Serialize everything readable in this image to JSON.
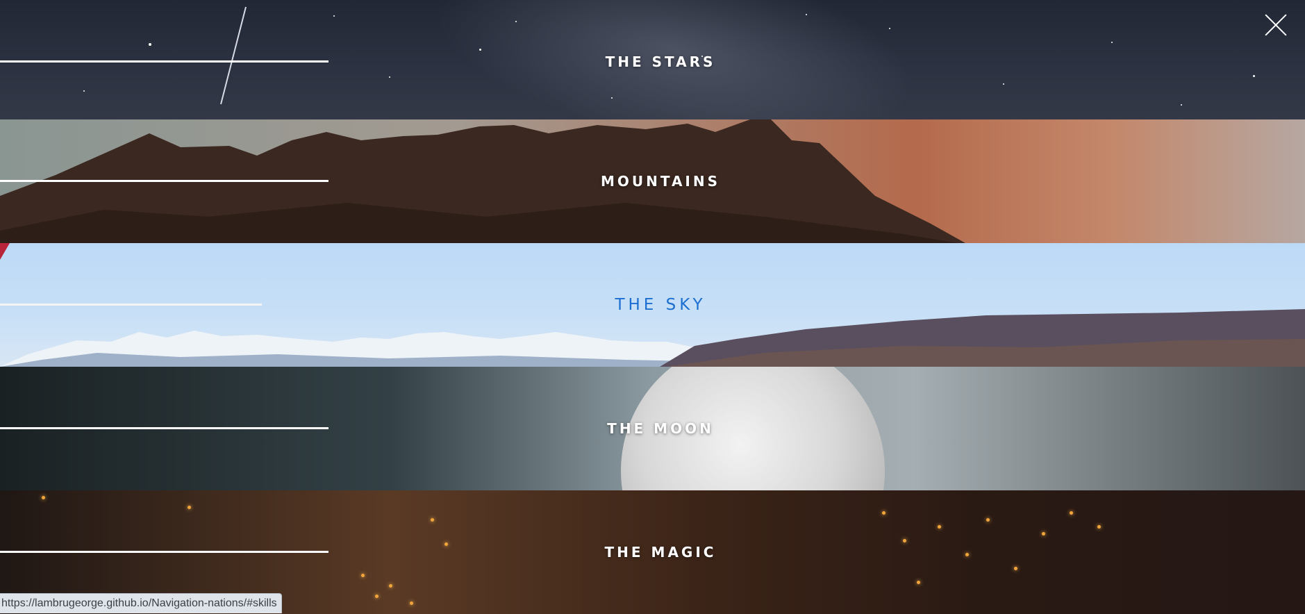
{
  "nav": {
    "items": [
      {
        "label": "THE STARS"
      },
      {
        "label": "MOUNTAINS"
      },
      {
        "label": "THE SKY"
      },
      {
        "label": "THE MOON"
      },
      {
        "label": "THE MAGIC"
      }
    ],
    "active_index": 2,
    "active_color": "#1c6fd0"
  },
  "close": {
    "icon": "close-icon"
  },
  "status_bar": {
    "url": "https://lambrugeorge.github.io/Navigation-nations/#skills"
  }
}
